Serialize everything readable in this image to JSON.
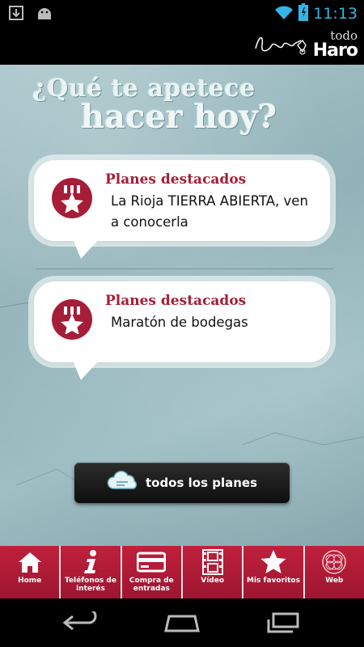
{
  "status_bar": {
    "time": "11:13",
    "left_icons": [
      "download-icon",
      "android-icon"
    ],
    "right_icons": [
      "wifi-icon",
      "battery-icon"
    ],
    "accent_color": "#33b5e5"
  },
  "app_header": {
    "logo_todo": "todo",
    "logo_haro": "Haro"
  },
  "main": {
    "headline_line1": "¿Qué te apetece",
    "headline_line2": "hacer hoy?",
    "cards": [
      {
        "title": "Planes destacados",
        "text": "La Rioja TIERRA ABIERTA, ven a conocerla"
      },
      {
        "title": "Planes destacados",
        "text": "Maratón de bodegas"
      }
    ],
    "all_plans_label": "todos los planes"
  },
  "tabs": [
    {
      "label": "Home",
      "icon": "home-icon"
    },
    {
      "label": "Teléfonos de interés",
      "icon": "info-icon"
    },
    {
      "label": "Compra de entradas",
      "icon": "card-icon"
    },
    {
      "label": "Vídeo",
      "icon": "film-icon"
    },
    {
      "label": "Mis favoritos",
      "icon": "star-icon"
    },
    {
      "label": "Web",
      "icon": "globe-icon"
    }
  ],
  "colors": {
    "brand_red": "#a51d37",
    "tabbar_red": "#b51b37",
    "background_teal": "#96b8bd"
  },
  "system_nav": [
    "back-icon",
    "home-icon",
    "recent-apps-icon"
  ]
}
